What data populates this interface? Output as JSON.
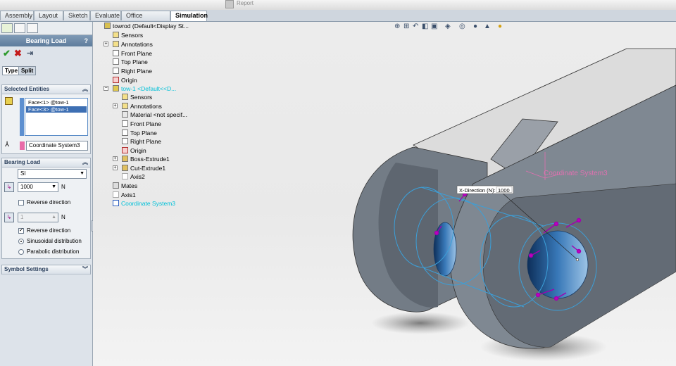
{
  "ribbon": {
    "report_label": "Report"
  },
  "tabs": [
    "Assembly",
    "Layout",
    "Sketch",
    "Evaluate",
    "Office Products",
    "Simulation"
  ],
  "property_manager": {
    "title": "Bearing Load",
    "help": "?",
    "ok_icon": "checkmark-icon",
    "cancel_icon": "x-icon",
    "pin_icon": "pushpin-icon",
    "sub_tabs": [
      "Type",
      "Split"
    ],
    "selected_entities": {
      "header": "Selected Entities",
      "faces": [
        "Face<1> @tow-1",
        "Face<3> @tow-1"
      ],
      "coordinate_system": "Coordinate System3"
    },
    "bearing_load": {
      "header": "Bearing Load",
      "units": "SI",
      "x_value": "1000",
      "x_unit": "N",
      "reverse_1": "Reverse direction",
      "y_value": "1",
      "y_unit": "N",
      "reverse_2": "Reverse direction",
      "sinusoidal": "Sinusoidal distribution",
      "parabolic": "Parabolic distribution"
    },
    "symbol_settings": "Symbol Settings"
  },
  "tree": {
    "root": "towrod  (Default<Display St...",
    "items": [
      "Sensors",
      "Annotations",
      "Front Plane",
      "Top Plane",
      "Right Plane",
      "Origin"
    ],
    "component": "tow-1 <Default<<D...",
    "component_items": [
      "Sensors",
      "Annotations",
      "Material <not specif...",
      "Front Plane",
      "Top Plane",
      "Right Plane",
      "Origin",
      "Boss-Extrude1",
      "Cut-Extrude1",
      "Axis2"
    ],
    "tail": [
      "Mates",
      "Axis1",
      "Coordinate System3"
    ]
  },
  "viewport": {
    "callout_label": "X-Direction (N):",
    "callout_value": "1000",
    "coord_label": "Coordinate System3"
  },
  "colors": {
    "accent": "#3d6fb3",
    "cyan": "#00c0d8",
    "magenta": "#c000c0"
  }
}
